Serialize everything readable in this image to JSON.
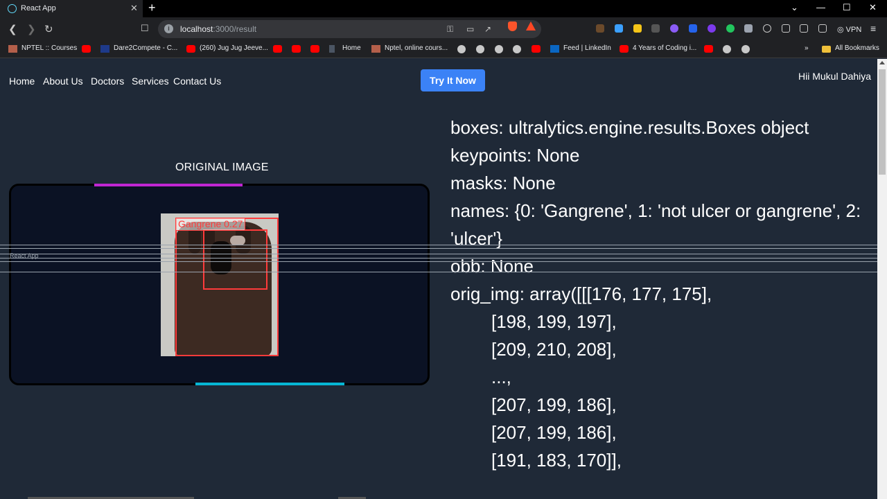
{
  "browser": {
    "tab_title": "React App",
    "tab_close": "✕",
    "new_tab": "+",
    "url_host": "localhost",
    "url_path": ":3000/result",
    "vpn_label": "VPN",
    "window_controls": {
      "chevron": "⌄",
      "minimize": "—",
      "maximize": "☐",
      "close": "✕"
    }
  },
  "bookmarks": {
    "items": [
      "NPTEL :: Courses",
      "Dare2Compete - C...",
      "(260) Jug Jug Jeeve...",
      "Home",
      "Nptel, online cours...",
      "Feed | LinkedIn",
      "4 Years of Coding i..."
    ],
    "overflow": "»",
    "all_bookmarks": "All Bookmarks"
  },
  "nav": {
    "links": [
      "Home",
      "About Us",
      "Doctors",
      "Services",
      "Contact Us"
    ],
    "cta": "Try It Now",
    "greeting": "Hii Mukul Dahiya"
  },
  "image_panel": {
    "title": "ORIGINAL IMAGE",
    "detection_label": "Gangrene  0.27"
  },
  "result": {
    "lines": [
      "boxes: ultralytics.engine.results.Boxes object",
      "keypoints: None",
      "masks: None",
      "names: {0: 'Gangrene', 1: 'not ulcer or gangrene', 2:",
      "'ulcer'}",
      "obb: None",
      "orig_img: array([[[176, 177, 175],"
    ],
    "array_rows": [
      "[198, 199, 197],",
      "[209, 210, 208],",
      "...,",
      "[207, 199, 186],",
      "[207, 199, 186],",
      "[191, 183, 170]],"
    ]
  },
  "glitch_ghost": "React App",
  "colors": {
    "page_bg": "#1f2937",
    "cta_blue": "#3b82f6",
    "accent_magenta": "#c026d3",
    "accent_cyan": "#06b6d4",
    "detection_red": "#ff3b3b"
  }
}
